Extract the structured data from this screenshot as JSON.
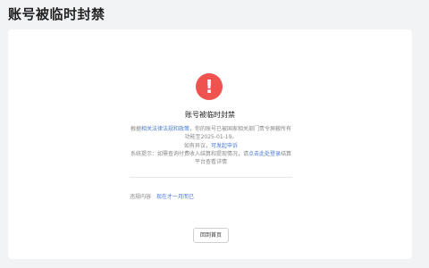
{
  "page": {
    "title": "账号被临时封禁"
  },
  "notice": {
    "icon": "exclamation-icon",
    "icon_glyph": "!",
    "icon_color": "#ef5350",
    "title": "账号被临时封禁",
    "body_prefix": "根据",
    "body_link": "相关法律法规和政策",
    "body_suffix": "，你的账号已被国家相关部门责令屏蔽所有功能至2025-01-19。",
    "appeal_prefix": "如有异议，",
    "appeal_link": "可发起申诉",
    "hint_prefix": "系统提示：如需查询付费收入结算和提现情况，请",
    "hint_link": "点击此处登录",
    "hint_suffix": "结算平台查看详情"
  },
  "meta": {
    "label": "违规内容",
    "value": "现在才一月而已"
  },
  "actions": {
    "home_label": "回到首页"
  }
}
